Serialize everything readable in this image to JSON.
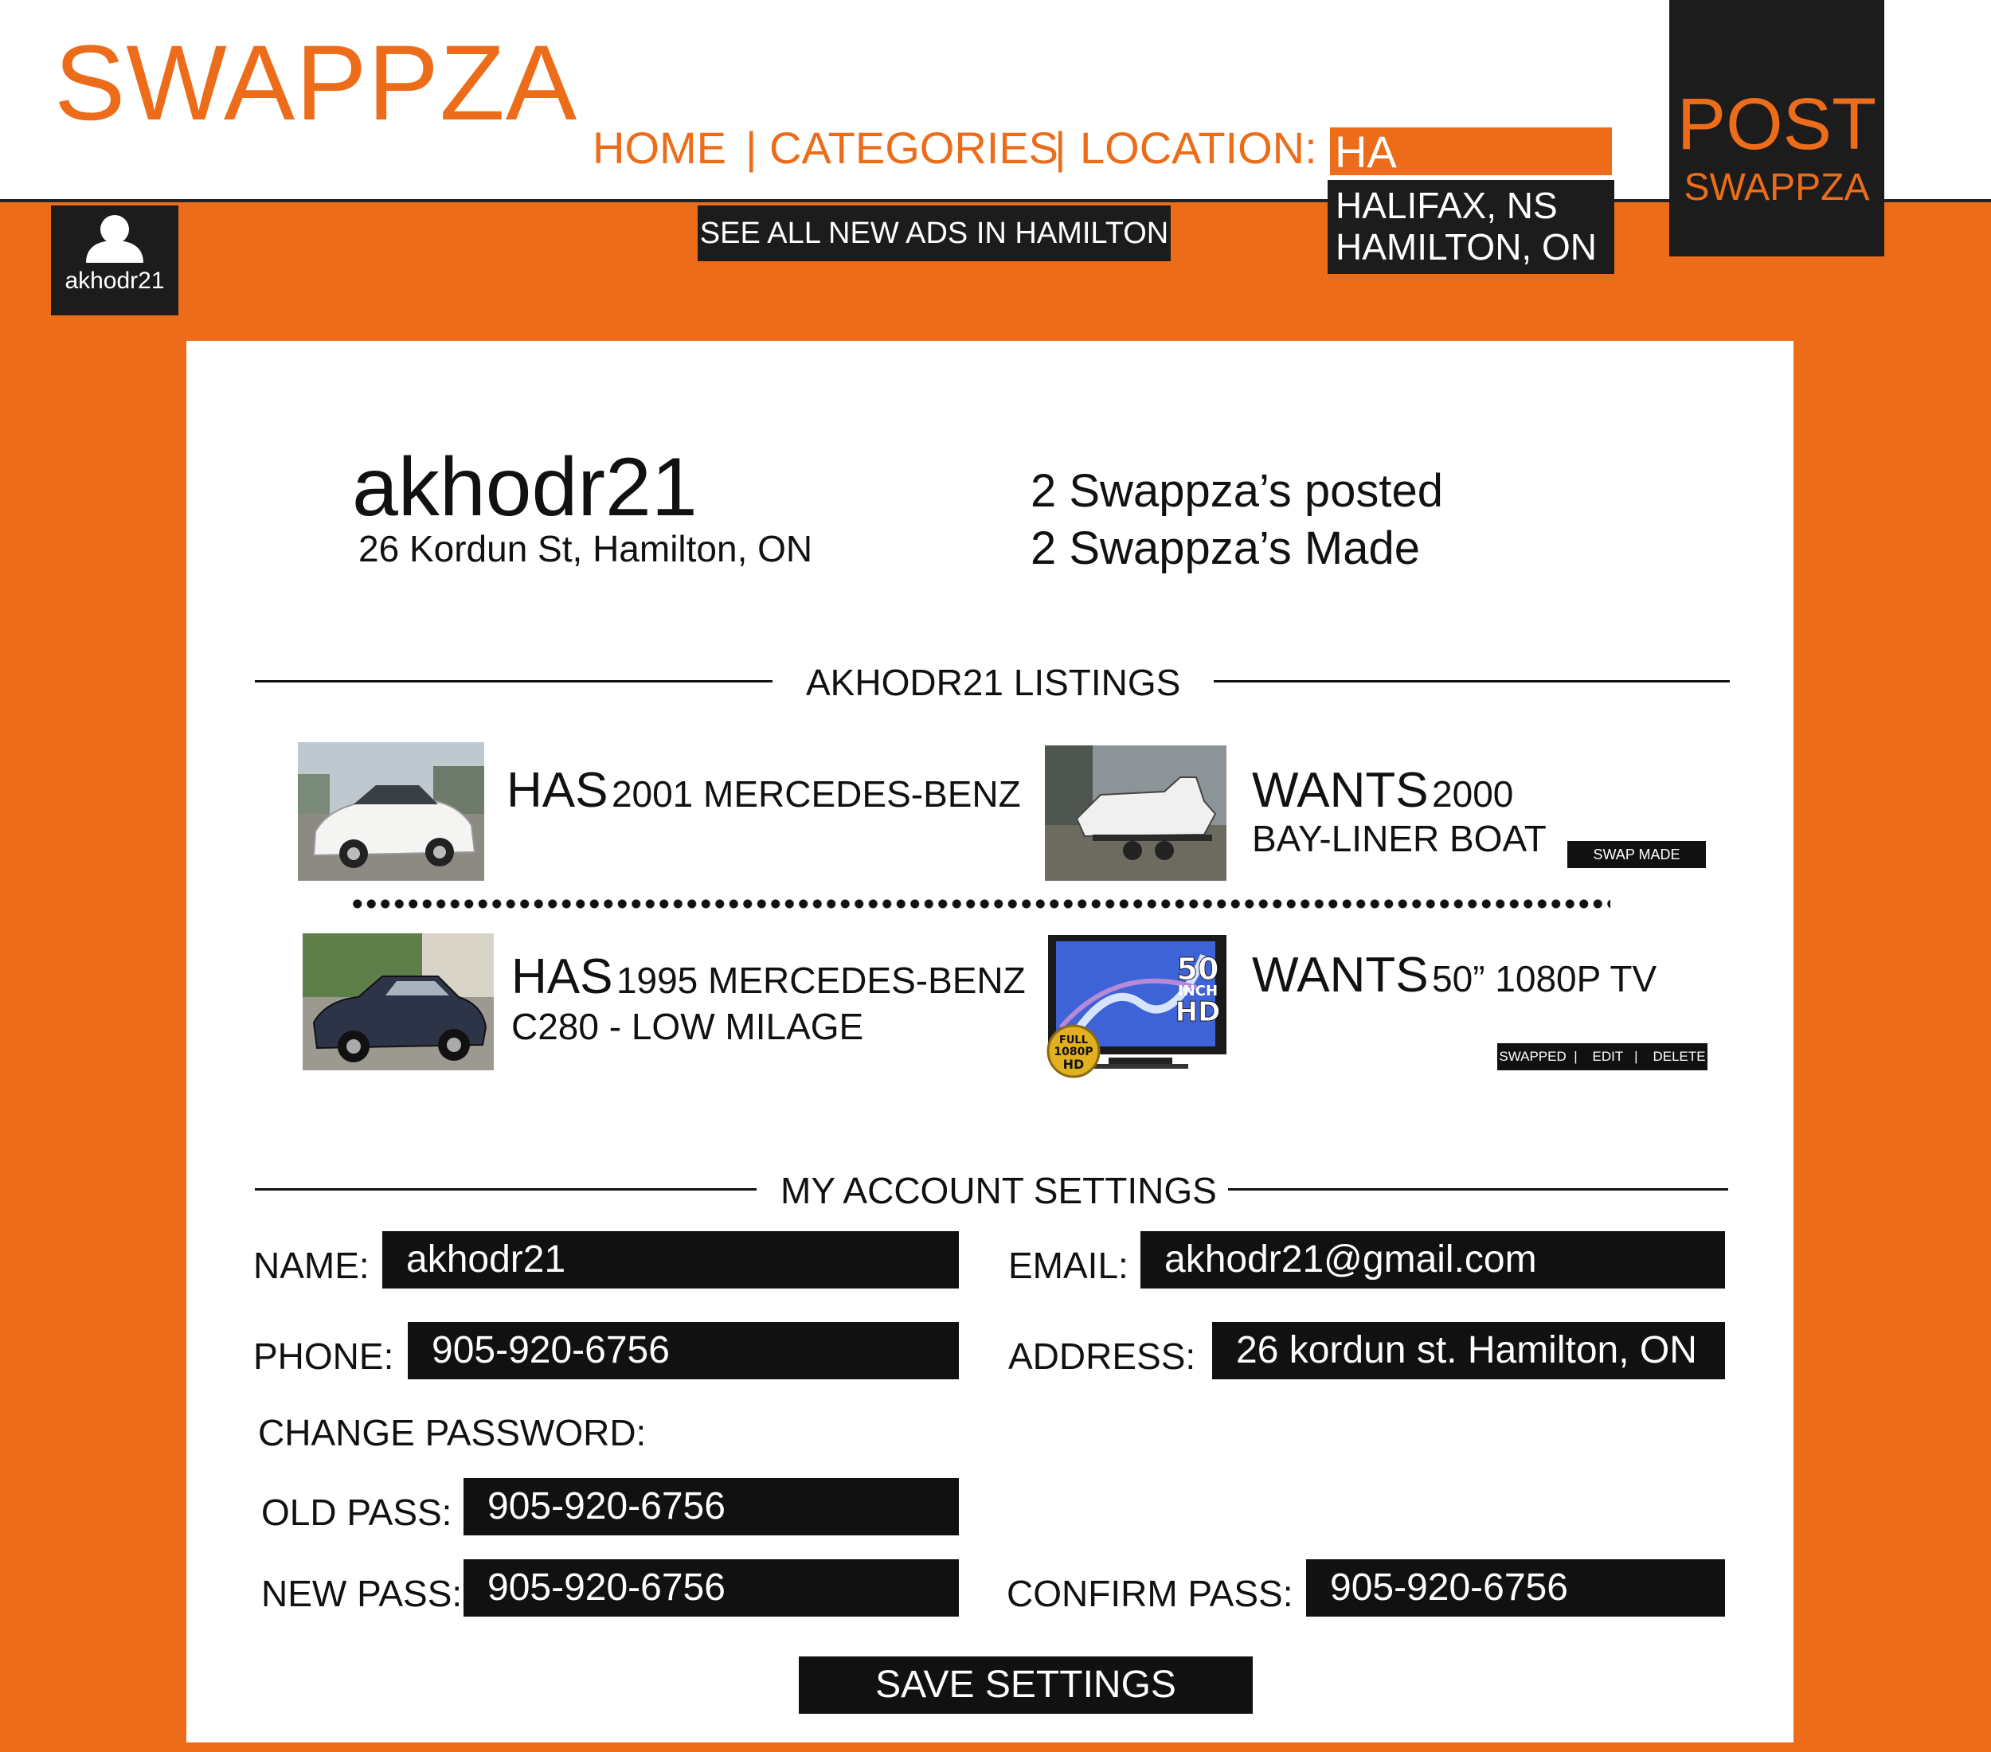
{
  "header": {
    "logo": "SWAPPZA",
    "nav_home": "HOME",
    "nav_categories": "CATEGORIES",
    "nav_location_label": "LOCATION:",
    "separator": "|",
    "location_input": "HA",
    "location_options": [
      "HALIFAX, NS",
      "HAMILTON, ON"
    ],
    "post_line1": "POST",
    "post_line2": "SWAPPZA",
    "see_all": "SEE ALL NEW ADS IN HAMILTON",
    "user_chip": "akhodr21"
  },
  "profile": {
    "username": "akhodr21",
    "address": "26 Kordun St, Hamilton, ON",
    "posted": "2 Swappza’s posted",
    "made": "2 Swappza’s Made"
  },
  "listings": {
    "title": "AKHODR21 LISTINGS",
    "items": [
      {
        "has_word": "HAS",
        "has_line1": "2001 MERCEDES-BENZ",
        "has_line2": "",
        "wants_word": "WANTS",
        "wants_line1": "2000",
        "wants_line2": "BAY-LINER BOAT",
        "status": "SWAP MADE"
      },
      {
        "has_word": "HAS",
        "has_line1": "1995 MERCEDES-BENZ",
        "has_line2": "C280 - LOW MILAGE",
        "wants_word": "WANTS",
        "wants_line1": "50” 1080P TV",
        "wants_line2": "",
        "actions": [
          "SWAPPED",
          "EDIT",
          "DELETE"
        ],
        "tv_badge_top": "50",
        "tv_badge_mid": "INCH",
        "tv_badge_bot": "HD",
        "tv_seal_1": "FULL",
        "tv_seal_2": "1080P",
        "tv_seal_3": "HD"
      }
    ]
  },
  "settings": {
    "title": "MY ACCOUNT SETTINGS",
    "name_label": "NAME:",
    "name_value": "akhodr21",
    "email_label": "EMAIL:",
    "email_value": "akhodr21@gmail.com",
    "phone_label": "PHONE:",
    "phone_value": "905-920-6756",
    "address_label": "ADDRESS:",
    "address_value": "26 kordun st. Hamilton, ON",
    "change_password": "CHANGE PASSWORD:",
    "old_label": "OLD PASS:",
    "old_value": "905-920-6756",
    "new_label": "NEW PASS:",
    "new_value": "905-920-6756",
    "confirm_label": "CONFIRM PASS:",
    "confirm_value": "905-920-6756",
    "save": "SAVE SETTINGS"
  },
  "colors": {
    "brand_orange": "#ec6c1a",
    "dark": "#1c1c1c",
    "white": "#ffffff"
  }
}
